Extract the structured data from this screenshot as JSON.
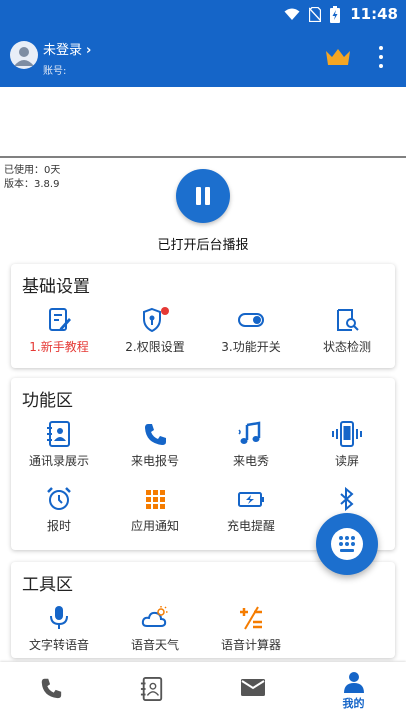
{
  "status_bar": {
    "time": "11:48"
  },
  "header": {
    "login_label": "未登录",
    "account_label": "账号:"
  },
  "usage": {
    "used_days": "已使用：0天",
    "version": "版本：3.8.9"
  },
  "broadcast": {
    "status": "已打开后台播报"
  },
  "basic_settings": {
    "title": "基础设置",
    "items": [
      {
        "label": "1.新手教程",
        "icon": "tutorial-icon",
        "highlight": true
      },
      {
        "label": "2.权限设置",
        "icon": "shield-icon",
        "badge": true
      },
      {
        "label": "3.功能开关",
        "icon": "toggle-icon"
      },
      {
        "label": "状态检测",
        "icon": "status-check-icon"
      }
    ]
  },
  "features": {
    "title": "功能区",
    "items": [
      {
        "label": "通讯录展示",
        "icon": "contacts-icon"
      },
      {
        "label": "来电报号",
        "icon": "phone-icon"
      },
      {
        "label": "来电秀",
        "icon": "music-icon"
      },
      {
        "label": "读屏",
        "icon": "vibrate-phone-icon"
      },
      {
        "label": "报时",
        "icon": "alarm-clock-icon"
      },
      {
        "label": "应用通知",
        "icon": "apps-grid-icon"
      },
      {
        "label": "充电提醒",
        "icon": "battery-charging-icon"
      },
      {
        "label": "蓝",
        "icon": "bluetooth-icon"
      }
    ]
  },
  "tools": {
    "title": "工具区",
    "items": [
      {
        "label": "文字转语音",
        "icon": "microphone-icon"
      },
      {
        "label": "语音天气",
        "icon": "weather-icon"
      },
      {
        "label": "语音计算器",
        "icon": "calculator-icon"
      }
    ]
  },
  "bottom_nav": [
    {
      "name": "phone",
      "icon": "phone-icon",
      "label": ""
    },
    {
      "name": "contacts",
      "icon": "contacts-icon",
      "label": ""
    },
    {
      "name": "messages",
      "icon": "mail-icon",
      "label": ""
    },
    {
      "name": "mine",
      "icon": "person-icon",
      "label": "我的",
      "active": true
    }
  ],
  "colors": {
    "primary": "#1565c8",
    "accent_red": "#e53935",
    "crown": "#f5a623",
    "icon_orange": "#f57c00"
  }
}
